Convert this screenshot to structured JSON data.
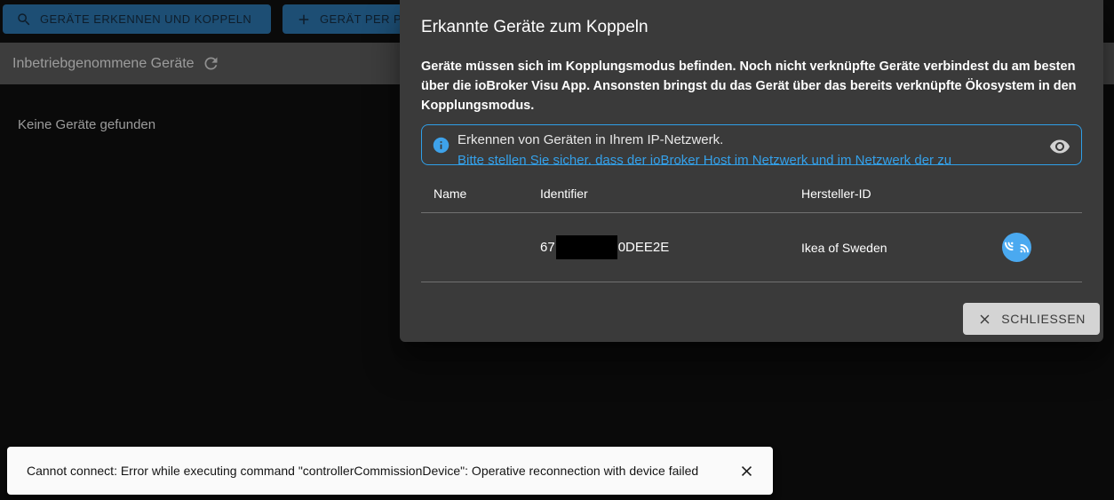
{
  "colors": {
    "page_bg": "#0a0a0a",
    "primary_button_bg": "#1d4e74",
    "primary_button_text": "#0e1d2b",
    "toolbar_bg": "#3d3d3d",
    "dialog_bg": "#3a3a3a",
    "info_accent_blue": "#2f9fe8",
    "pair_icon_blue": "#4aa9f0",
    "close_button_bg": "#d4d4d4",
    "snackbar_bg": "#fafafa"
  },
  "icons": {
    "detect": "magnifier",
    "add": "plus",
    "refresh": "circular-arrow",
    "info": "info-circle",
    "eye": "visibility",
    "pair": "wireless-pairing",
    "close": "x-cross"
  },
  "top": {
    "detect_button_label": "GERÄTE ERKENNEN UND KOPPELN",
    "add_button_label": "GERÄT PER PA",
    "commissioned_label": "Inbetriebgenommene Geräte"
  },
  "main": {
    "empty_text": "Keine Geräte gefunden"
  },
  "dialog": {
    "title": "Erkannte Geräte zum Koppeln",
    "description": "Geräte müssen sich im Kopplungsmodus befinden. Noch nicht verknüpfte Geräte verbindest du am besten über die ioBroker Visu App. Ansonsten bringst du das Gerät über das bereits verknüpfte Ökosystem in den Kopplungsmodus.",
    "info": {
      "line1": "Erkennen von Geräten in Ihrem IP-Netzwerk.",
      "line2": "Bitte stellen Sie sicher, dass der ioBroker Host im Netzwerk und im Netzwerk der zu"
    },
    "table": {
      "headers": [
        "Name",
        "Identifier",
        "Hersteller-ID"
      ],
      "rows": [
        {
          "name": "",
          "identifier_prefix": "67",
          "identifier_suffix": "0DEE2E",
          "vendor": "Ikea of Sweden"
        }
      ]
    },
    "close_button_label": "SCHLIESSEN"
  },
  "snackbar": {
    "message": "Cannot connect: Error while executing command \"controllerCommissionDevice\": Operative reconnection with device failed"
  }
}
